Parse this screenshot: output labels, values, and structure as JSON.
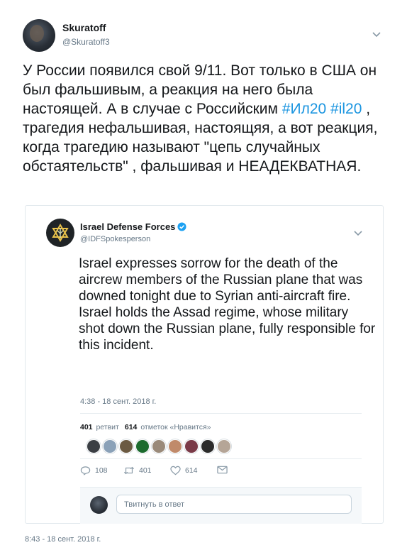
{
  "tweet": {
    "author_name": "Skuratoff",
    "author_handle": "@Skuratoff3",
    "text_before": "У России появился свой 9/11. Вот только в США он был фальшивым, а реакция на него была настоящей. А в случае с Российским ",
    "hashtag_1": "#Ил20",
    "hashtag_2": "#il20",
    "text_after": " , трагедия нефальшивая, настоящяя, а вот реакция, когда трагедию называют \"цепь случайных обстаятельств\" , фальшивая и НЕАДЕКВАТНАЯ.",
    "timestamp": "8:43 - 18 сент. 2018 г."
  },
  "quoted": {
    "author_name": "Israel Defense Forces",
    "author_handle": "@IDFSpokesperson",
    "text": "Israel expresses sorrow for the death of the aircrew members of the Russian plane that was downed tonight due to Syrian anti-aircraft fire.\nIsrael holds the Assad regime, whose military shot down the Russian plane, fully responsible for this incident.",
    "timestamp": "4:38 - 18 сент. 2018 г.",
    "retweets_count": "401",
    "retweets_label": "ретвит",
    "likes_count": "614",
    "likes_label": "отметок «Нравится»",
    "actions": {
      "reply_count": "108",
      "retweet_count": "401",
      "like_count": "614"
    },
    "reply_placeholder": "Твитнуть в ответ"
  },
  "colors": {
    "hashtag": "#1b95e0",
    "muted": "#657786",
    "text": "#14171a",
    "verified": "#1da1f2"
  },
  "icons": {
    "dropdown": "chevron-down-icon",
    "verified": "verified-badge-icon",
    "reply": "reply-icon",
    "retweet": "retweet-icon",
    "like": "heart-icon",
    "dm": "envelope-icon",
    "idf_logo": "idf-emblem-icon"
  }
}
